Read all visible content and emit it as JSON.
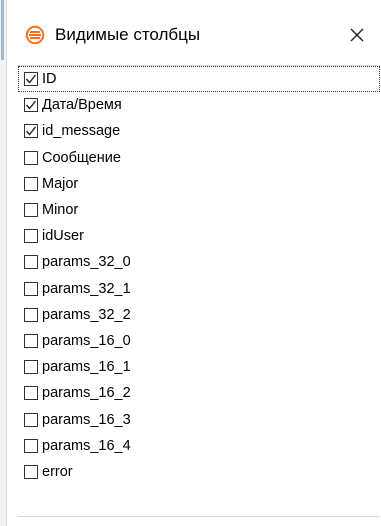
{
  "window": {
    "title": "Видимые столбцы",
    "title_icon": "layers-icon",
    "close_icon": "close-icon",
    "accent_color": "#f2711c"
  },
  "columns": [
    {
      "label": "ID",
      "checked": true,
      "focused": true
    },
    {
      "label": "Дата/Время",
      "checked": true
    },
    {
      "label": "id_message",
      "checked": true
    },
    {
      "label": "Сообщение",
      "checked": false
    },
    {
      "label": "Major",
      "checked": false
    },
    {
      "label": "Minor",
      "checked": false
    },
    {
      "label": "idUser",
      "checked": false
    },
    {
      "label": "params_32_0",
      "checked": false
    },
    {
      "label": "params_32_1",
      "checked": false
    },
    {
      "label": "params_32_2",
      "checked": false
    },
    {
      "label": "params_16_0",
      "checked": false
    },
    {
      "label": "params_16_1",
      "checked": false
    },
    {
      "label": "params_16_2",
      "checked": false
    },
    {
      "label": "params_16_3",
      "checked": false
    },
    {
      "label": "params_16_4",
      "checked": false
    },
    {
      "label": "error",
      "checked": false
    }
  ]
}
